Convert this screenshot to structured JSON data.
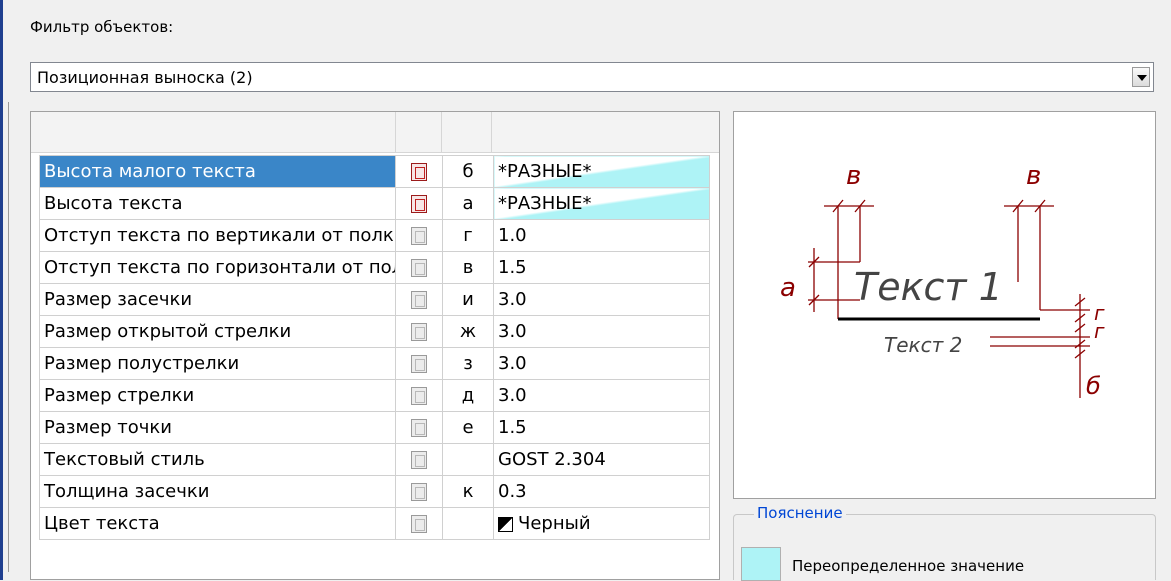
{
  "filter": {
    "label": "Фильтр объектов:",
    "selected": "Позиционная выноска (2)"
  },
  "rows": [
    {
      "name": "Высота малого текста",
      "letter": "б",
      "value": "*РАЗНЫЕ*"
    },
    {
      "name": "Высота текста",
      "letter": "а",
      "value": "*РАЗНЫЕ*"
    },
    {
      "name": "Отступ текста по вертикали от полки",
      "letter": "г",
      "value": "1.0"
    },
    {
      "name": "Отступ текста по горизонтали от полки",
      "letter": "в",
      "value": "1.5"
    },
    {
      "name": "Размер засечки",
      "letter": "и",
      "value": "3.0"
    },
    {
      "name": "Размер открытой стрелки",
      "letter": "ж",
      "value": "3.0"
    },
    {
      "name": "Размер полустрелки",
      "letter": "з",
      "value": "3.0"
    },
    {
      "name": "Размер стрелки",
      "letter": "д",
      "value": "3.0"
    },
    {
      "name": "Размер точки",
      "letter": "е",
      "value": "1.5"
    },
    {
      "name": "Текстовый стиль",
      "letter": "",
      "value": "GOST 2.304"
    },
    {
      "name": "Толщина засечки",
      "letter": "к",
      "value": "0.3"
    },
    {
      "name": "Цвет текста",
      "letter": "",
      "value": "Черный"
    }
  ],
  "preview": {
    "text1": "Текст 1",
    "text2": "Текст 2",
    "dim_v_left": "в",
    "dim_v_right": "в",
    "dim_a": "а",
    "dim_g1": "г",
    "dim_g2": "г",
    "dim_b": "б"
  },
  "explanation": {
    "title": "Пояснение",
    "legend_label": "Переопределенное значение"
  },
  "colors": {
    "dimension": "#8b0000",
    "override": "#aef3f6",
    "selection": "#3a86c8",
    "group_title": "#0046d5"
  },
  "icons": {
    "reset": "reset-to-default-icon",
    "color_swatch": "black-color-swatch-icon",
    "dropdown": "dropdown-arrow-icon"
  }
}
